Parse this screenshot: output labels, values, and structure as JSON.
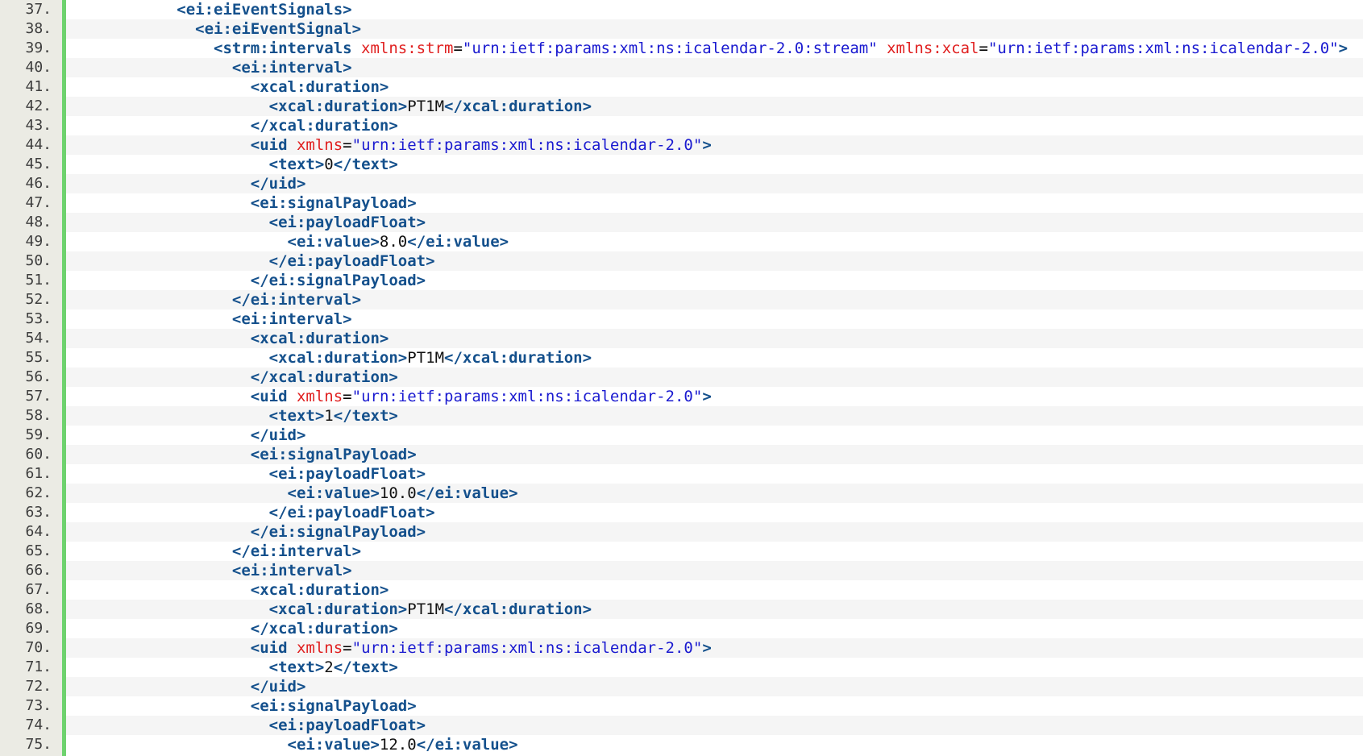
{
  "colors": {
    "gutter_background": "#ebebe4",
    "change_bar": "#6ed26e",
    "tag": "#14508c",
    "attribute": "#e02020",
    "attribute_value": "#1a1ad0",
    "text": "#111111",
    "alt_row": "#f5f5f5"
  },
  "lines": [
    {
      "num": "37.",
      "indent": 6,
      "tokens": [
        {
          "t": "tag",
          "v": "<ei:eiEventSignals>"
        }
      ]
    },
    {
      "num": "38.",
      "indent": 7,
      "tokens": [
        {
          "t": "tag",
          "v": "<ei:eiEventSignal>"
        }
      ]
    },
    {
      "num": "39.",
      "indent": 8,
      "tokens": [
        {
          "t": "tag",
          "v": "<strm:intervals "
        },
        {
          "t": "attr",
          "v": "xmlns:strm"
        },
        {
          "t": "punc",
          "v": "="
        },
        {
          "t": "val",
          "v": "\"urn:ietf:params:xml:ns:icalendar-2.0:stream\""
        },
        {
          "t": "punc",
          "v": " "
        },
        {
          "t": "attr",
          "v": "xmlns:xcal"
        },
        {
          "t": "punc",
          "v": "="
        },
        {
          "t": "val",
          "v": "\"urn:ietf:params:xml:ns:icalendar-2.0\""
        },
        {
          "t": "tag",
          "v": ">"
        }
      ]
    },
    {
      "num": "40.",
      "indent": 9,
      "tokens": [
        {
          "t": "tag",
          "v": "<ei:interval>"
        }
      ]
    },
    {
      "num": "41.",
      "indent": 10,
      "tokens": [
        {
          "t": "tag",
          "v": "<xcal:duration>"
        }
      ]
    },
    {
      "num": "42.",
      "indent": 11,
      "tokens": [
        {
          "t": "tag",
          "v": "<xcal:duration>"
        },
        {
          "t": "txt",
          "v": "PT1M"
        },
        {
          "t": "tag",
          "v": "</xcal:duration>"
        }
      ]
    },
    {
      "num": "43.",
      "indent": 10,
      "tokens": [
        {
          "t": "tag",
          "v": "</xcal:duration>"
        }
      ]
    },
    {
      "num": "44.",
      "indent": 10,
      "tokens": [
        {
          "t": "tag",
          "v": "<uid "
        },
        {
          "t": "attr",
          "v": "xmlns"
        },
        {
          "t": "punc",
          "v": "="
        },
        {
          "t": "val",
          "v": "\"urn:ietf:params:xml:ns:icalendar-2.0\""
        },
        {
          "t": "tag",
          "v": ">"
        }
      ]
    },
    {
      "num": "45.",
      "indent": 11,
      "tokens": [
        {
          "t": "tag",
          "v": "<text>"
        },
        {
          "t": "txt",
          "v": "0"
        },
        {
          "t": "tag",
          "v": "</text>"
        }
      ]
    },
    {
      "num": "46.",
      "indent": 10,
      "tokens": [
        {
          "t": "tag",
          "v": "</uid>"
        }
      ]
    },
    {
      "num": "47.",
      "indent": 10,
      "tokens": [
        {
          "t": "tag",
          "v": "<ei:signalPayload>"
        }
      ]
    },
    {
      "num": "48.",
      "indent": 11,
      "tokens": [
        {
          "t": "tag",
          "v": "<ei:payloadFloat>"
        }
      ]
    },
    {
      "num": "49.",
      "indent": 12,
      "tokens": [
        {
          "t": "tag",
          "v": "<ei:value>"
        },
        {
          "t": "txt",
          "v": "8.0"
        },
        {
          "t": "tag",
          "v": "</ei:value>"
        }
      ]
    },
    {
      "num": "50.",
      "indent": 11,
      "tokens": [
        {
          "t": "tag",
          "v": "</ei:payloadFloat>"
        }
      ]
    },
    {
      "num": "51.",
      "indent": 10,
      "tokens": [
        {
          "t": "tag",
          "v": "</ei:signalPayload>"
        }
      ]
    },
    {
      "num": "52.",
      "indent": 9,
      "tokens": [
        {
          "t": "tag",
          "v": "</ei:interval>"
        }
      ]
    },
    {
      "num": "53.",
      "indent": 9,
      "tokens": [
        {
          "t": "tag",
          "v": "<ei:interval>"
        }
      ]
    },
    {
      "num": "54.",
      "indent": 10,
      "tokens": [
        {
          "t": "tag",
          "v": "<xcal:duration>"
        }
      ]
    },
    {
      "num": "55.",
      "indent": 11,
      "tokens": [
        {
          "t": "tag",
          "v": "<xcal:duration>"
        },
        {
          "t": "txt",
          "v": "PT1M"
        },
        {
          "t": "tag",
          "v": "</xcal:duration>"
        }
      ]
    },
    {
      "num": "56.",
      "indent": 10,
      "tokens": [
        {
          "t": "tag",
          "v": "</xcal:duration>"
        }
      ]
    },
    {
      "num": "57.",
      "indent": 10,
      "tokens": [
        {
          "t": "tag",
          "v": "<uid "
        },
        {
          "t": "attr",
          "v": "xmlns"
        },
        {
          "t": "punc",
          "v": "="
        },
        {
          "t": "val",
          "v": "\"urn:ietf:params:xml:ns:icalendar-2.0\""
        },
        {
          "t": "tag",
          "v": ">"
        }
      ]
    },
    {
      "num": "58.",
      "indent": 11,
      "tokens": [
        {
          "t": "tag",
          "v": "<text>"
        },
        {
          "t": "txt",
          "v": "1"
        },
        {
          "t": "tag",
          "v": "</text>"
        }
      ]
    },
    {
      "num": "59.",
      "indent": 10,
      "tokens": [
        {
          "t": "tag",
          "v": "</uid>"
        }
      ]
    },
    {
      "num": "60.",
      "indent": 10,
      "tokens": [
        {
          "t": "tag",
          "v": "<ei:signalPayload>"
        }
      ]
    },
    {
      "num": "61.",
      "indent": 11,
      "tokens": [
        {
          "t": "tag",
          "v": "<ei:payloadFloat>"
        }
      ]
    },
    {
      "num": "62.",
      "indent": 12,
      "tokens": [
        {
          "t": "tag",
          "v": "<ei:value>"
        },
        {
          "t": "txt",
          "v": "10.0"
        },
        {
          "t": "tag",
          "v": "</ei:value>"
        }
      ]
    },
    {
      "num": "63.",
      "indent": 11,
      "tokens": [
        {
          "t": "tag",
          "v": "</ei:payloadFloat>"
        }
      ]
    },
    {
      "num": "64.",
      "indent": 10,
      "tokens": [
        {
          "t": "tag",
          "v": "</ei:signalPayload>"
        }
      ]
    },
    {
      "num": "65.",
      "indent": 9,
      "tokens": [
        {
          "t": "tag",
          "v": "</ei:interval>"
        }
      ]
    },
    {
      "num": "66.",
      "indent": 9,
      "tokens": [
        {
          "t": "tag",
          "v": "<ei:interval>"
        }
      ]
    },
    {
      "num": "67.",
      "indent": 10,
      "tokens": [
        {
          "t": "tag",
          "v": "<xcal:duration>"
        }
      ]
    },
    {
      "num": "68.",
      "indent": 11,
      "tokens": [
        {
          "t": "tag",
          "v": "<xcal:duration>"
        },
        {
          "t": "txt",
          "v": "PT1M"
        },
        {
          "t": "tag",
          "v": "</xcal:duration>"
        }
      ]
    },
    {
      "num": "69.",
      "indent": 10,
      "tokens": [
        {
          "t": "tag",
          "v": "</xcal:duration>"
        }
      ]
    },
    {
      "num": "70.",
      "indent": 10,
      "tokens": [
        {
          "t": "tag",
          "v": "<uid "
        },
        {
          "t": "attr",
          "v": "xmlns"
        },
        {
          "t": "punc",
          "v": "="
        },
        {
          "t": "val",
          "v": "\"urn:ietf:params:xml:ns:icalendar-2.0\""
        },
        {
          "t": "tag",
          "v": ">"
        }
      ]
    },
    {
      "num": "71.",
      "indent": 11,
      "tokens": [
        {
          "t": "tag",
          "v": "<text>"
        },
        {
          "t": "txt",
          "v": "2"
        },
        {
          "t": "tag",
          "v": "</text>"
        }
      ]
    },
    {
      "num": "72.",
      "indent": 10,
      "tokens": [
        {
          "t": "tag",
          "v": "</uid>"
        }
      ]
    },
    {
      "num": "73.",
      "indent": 10,
      "tokens": [
        {
          "t": "tag",
          "v": "<ei:signalPayload>"
        }
      ]
    },
    {
      "num": "74.",
      "indent": 11,
      "tokens": [
        {
          "t": "tag",
          "v": "<ei:payloadFloat>"
        }
      ]
    },
    {
      "num": "75.",
      "indent": 12,
      "tokens": [
        {
          "t": "tag",
          "v": "<ei:value>"
        },
        {
          "t": "txt",
          "v": "12.0"
        },
        {
          "t": "tag",
          "v": "</ei:value>"
        }
      ]
    }
  ]
}
